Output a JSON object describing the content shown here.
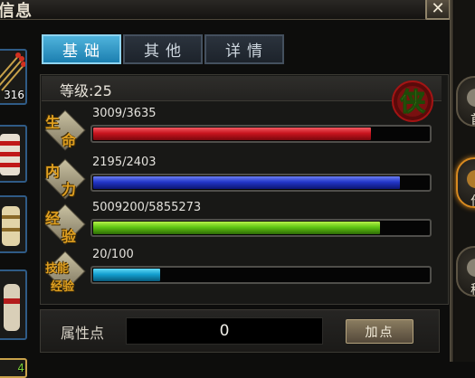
{
  "window": {
    "title": "信息",
    "close_glyph": "✕"
  },
  "tabs": [
    {
      "label": "基础",
      "active": true
    },
    {
      "label": "其他",
      "active": false
    },
    {
      "label": "详情",
      "active": false
    }
  ],
  "level": {
    "label": "等级:25"
  },
  "emblem": {
    "glyph": "侠",
    "icon": "xia-emblem-icon"
  },
  "stats": [
    {
      "icon": "health-icon",
      "icon_chars": [
        "生",
        "命"
      ],
      "value_text": "3009/3635",
      "current": 3009,
      "max": 3635,
      "color": "#d21a24"
    },
    {
      "icon": "mana-icon",
      "icon_chars": [
        "内",
        "力"
      ],
      "value_text": "2195/2403",
      "current": 2195,
      "max": 2403,
      "color": "#2638cc"
    },
    {
      "icon": "experience-icon",
      "icon_chars": [
        "经",
        "验"
      ],
      "value_text": "5009200/5855273",
      "current": 5009200,
      "max": 5855273,
      "color": "#63c816"
    },
    {
      "icon": "skill-exp-icon",
      "icon_chars": [
        "技能",
        "经验"
      ],
      "value_text": "20/100",
      "current": 20,
      "max": 100,
      "color": "#15a3d4"
    }
  ],
  "attributes": {
    "label": "属性点",
    "value": "0",
    "add_button": "加点"
  },
  "inventory": {
    "first_slot_count": "316",
    "last_slot_count": "4"
  },
  "side_menu": {
    "labels": [
      "首",
      "作",
      "秘"
    ]
  }
}
